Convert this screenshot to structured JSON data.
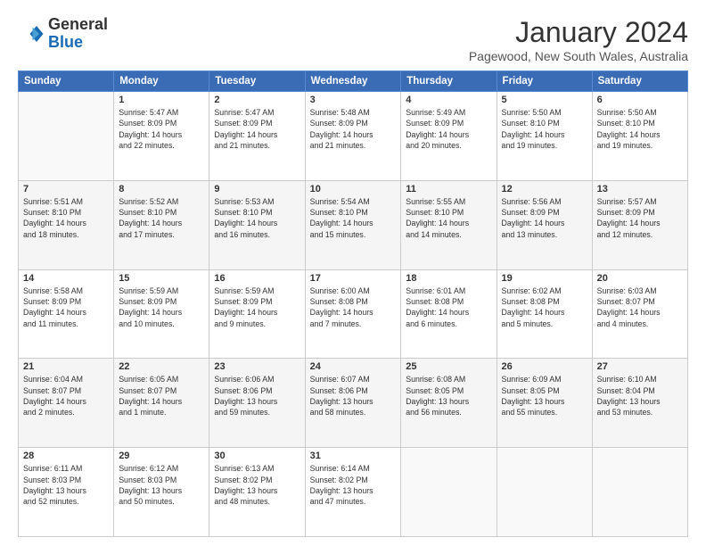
{
  "logo": {
    "general": "General",
    "blue": "Blue"
  },
  "title": {
    "month": "January 2024",
    "location": "Pagewood, New South Wales, Australia"
  },
  "header_days": [
    "Sunday",
    "Monday",
    "Tuesday",
    "Wednesday",
    "Thursday",
    "Friday",
    "Saturday"
  ],
  "weeks": [
    {
      "shade": false,
      "days": [
        {
          "num": "",
          "empty": true
        },
        {
          "num": "1",
          "info": "Sunrise: 5:47 AM\nSunset: 8:09 PM\nDaylight: 14 hours\nand 22 minutes."
        },
        {
          "num": "2",
          "info": "Sunrise: 5:47 AM\nSunset: 8:09 PM\nDaylight: 14 hours\nand 21 minutes."
        },
        {
          "num": "3",
          "info": "Sunrise: 5:48 AM\nSunset: 8:09 PM\nDaylight: 14 hours\nand 21 minutes."
        },
        {
          "num": "4",
          "info": "Sunrise: 5:49 AM\nSunset: 8:09 PM\nDaylight: 14 hours\nand 20 minutes."
        },
        {
          "num": "5",
          "info": "Sunrise: 5:50 AM\nSunset: 8:10 PM\nDaylight: 14 hours\nand 19 minutes."
        },
        {
          "num": "6",
          "info": "Sunrise: 5:50 AM\nSunset: 8:10 PM\nDaylight: 14 hours\nand 19 minutes."
        }
      ]
    },
    {
      "shade": true,
      "days": [
        {
          "num": "7",
          "info": "Sunrise: 5:51 AM\nSunset: 8:10 PM\nDaylight: 14 hours\nand 18 minutes."
        },
        {
          "num": "8",
          "info": "Sunrise: 5:52 AM\nSunset: 8:10 PM\nDaylight: 14 hours\nand 17 minutes."
        },
        {
          "num": "9",
          "info": "Sunrise: 5:53 AM\nSunset: 8:10 PM\nDaylight: 14 hours\nand 16 minutes."
        },
        {
          "num": "10",
          "info": "Sunrise: 5:54 AM\nSunset: 8:10 PM\nDaylight: 14 hours\nand 15 minutes."
        },
        {
          "num": "11",
          "info": "Sunrise: 5:55 AM\nSunset: 8:10 PM\nDaylight: 14 hours\nand 14 minutes."
        },
        {
          "num": "12",
          "info": "Sunrise: 5:56 AM\nSunset: 8:09 PM\nDaylight: 14 hours\nand 13 minutes."
        },
        {
          "num": "13",
          "info": "Sunrise: 5:57 AM\nSunset: 8:09 PM\nDaylight: 14 hours\nand 12 minutes."
        }
      ]
    },
    {
      "shade": false,
      "days": [
        {
          "num": "14",
          "info": "Sunrise: 5:58 AM\nSunset: 8:09 PM\nDaylight: 14 hours\nand 11 minutes."
        },
        {
          "num": "15",
          "info": "Sunrise: 5:59 AM\nSunset: 8:09 PM\nDaylight: 14 hours\nand 10 minutes."
        },
        {
          "num": "16",
          "info": "Sunrise: 5:59 AM\nSunset: 8:09 PM\nDaylight: 14 hours\nand 9 minutes."
        },
        {
          "num": "17",
          "info": "Sunrise: 6:00 AM\nSunset: 8:08 PM\nDaylight: 14 hours\nand 7 minutes."
        },
        {
          "num": "18",
          "info": "Sunrise: 6:01 AM\nSunset: 8:08 PM\nDaylight: 14 hours\nand 6 minutes."
        },
        {
          "num": "19",
          "info": "Sunrise: 6:02 AM\nSunset: 8:08 PM\nDaylight: 14 hours\nand 5 minutes."
        },
        {
          "num": "20",
          "info": "Sunrise: 6:03 AM\nSunset: 8:07 PM\nDaylight: 14 hours\nand 4 minutes."
        }
      ]
    },
    {
      "shade": true,
      "days": [
        {
          "num": "21",
          "info": "Sunrise: 6:04 AM\nSunset: 8:07 PM\nDaylight: 14 hours\nand 2 minutes."
        },
        {
          "num": "22",
          "info": "Sunrise: 6:05 AM\nSunset: 8:07 PM\nDaylight: 14 hours\nand 1 minute."
        },
        {
          "num": "23",
          "info": "Sunrise: 6:06 AM\nSunset: 8:06 PM\nDaylight: 13 hours\nand 59 minutes."
        },
        {
          "num": "24",
          "info": "Sunrise: 6:07 AM\nSunset: 8:06 PM\nDaylight: 13 hours\nand 58 minutes."
        },
        {
          "num": "25",
          "info": "Sunrise: 6:08 AM\nSunset: 8:05 PM\nDaylight: 13 hours\nand 56 minutes."
        },
        {
          "num": "26",
          "info": "Sunrise: 6:09 AM\nSunset: 8:05 PM\nDaylight: 13 hours\nand 55 minutes."
        },
        {
          "num": "27",
          "info": "Sunrise: 6:10 AM\nSunset: 8:04 PM\nDaylight: 13 hours\nand 53 minutes."
        }
      ]
    },
    {
      "shade": false,
      "days": [
        {
          "num": "28",
          "info": "Sunrise: 6:11 AM\nSunset: 8:03 PM\nDaylight: 13 hours\nand 52 minutes."
        },
        {
          "num": "29",
          "info": "Sunrise: 6:12 AM\nSunset: 8:03 PM\nDaylight: 13 hours\nand 50 minutes."
        },
        {
          "num": "30",
          "info": "Sunrise: 6:13 AM\nSunset: 8:02 PM\nDaylight: 13 hours\nand 48 minutes."
        },
        {
          "num": "31",
          "info": "Sunrise: 6:14 AM\nSunset: 8:02 PM\nDaylight: 13 hours\nand 47 minutes."
        },
        {
          "num": "",
          "empty": true
        },
        {
          "num": "",
          "empty": true
        },
        {
          "num": "",
          "empty": true
        }
      ]
    }
  ]
}
